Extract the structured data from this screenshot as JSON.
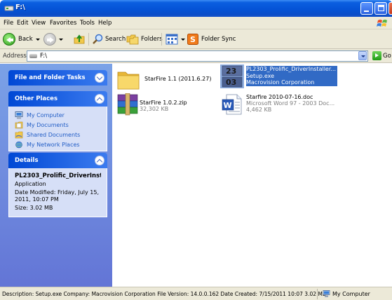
{
  "window": {
    "title": "F:\\"
  },
  "menu": {
    "items": [
      "File",
      "Edit",
      "View",
      "Favorites",
      "Tools",
      "Help"
    ]
  },
  "toolbar": {
    "back_label": "Back",
    "search_label": "Search",
    "folders_label": "Folders",
    "folder_sync_label": "Folder Sync"
  },
  "address": {
    "label": "Address",
    "value": "F:\\",
    "go_label": "Go"
  },
  "tasks": {
    "file_folder_title": "File and Folder Tasks",
    "other_places_title": "Other Places",
    "other_places": [
      "My Computer",
      "My Documents",
      "Shared Documents",
      "My Network Places"
    ],
    "details_title": "Details",
    "details_name": "PL2303_Prolific_DriverInsta",
    "details_type": "Application",
    "details_modified": "Date Modified: Friday, July 15, 2011, 10:07 PM",
    "details_size": "Size: 3.02 MB"
  },
  "files": [
    {
      "name": "StarFire 1.1 (2011.6.27)",
      "sub1": "",
      "sub2": "",
      "icon": "folder-icon"
    },
    {
      "name": "PL2303_Prolific_DriverInstaller...",
      "sub1": "Setup.exe",
      "sub2": "Macrovision Corporation",
      "icon": "installer-icon"
    },
    {
      "name": "StarFire 1.0.2.zip",
      "sub1": "32,302 KB",
      "sub2": "",
      "icon": "winrar-archive-icon"
    },
    {
      "name": "Starfire 2010-07-16.doc",
      "sub1": "Microsoft Word 97 - 2003 Doc...",
      "sub2": "4,462 KB",
      "icon": "word-document-icon"
    }
  ],
  "status": {
    "description": "Description: Setup.exe Company: Macrovision Corporation File Version: 14.0.0.162 Date Created: 7/15/2011 10:07 3.02 MB",
    "zone": "My Computer"
  },
  "colors": {
    "titlebar": "#0553d6",
    "selection": "#316ac5",
    "task_pane": "#7ba2e7",
    "task_link": "#215dc6"
  }
}
